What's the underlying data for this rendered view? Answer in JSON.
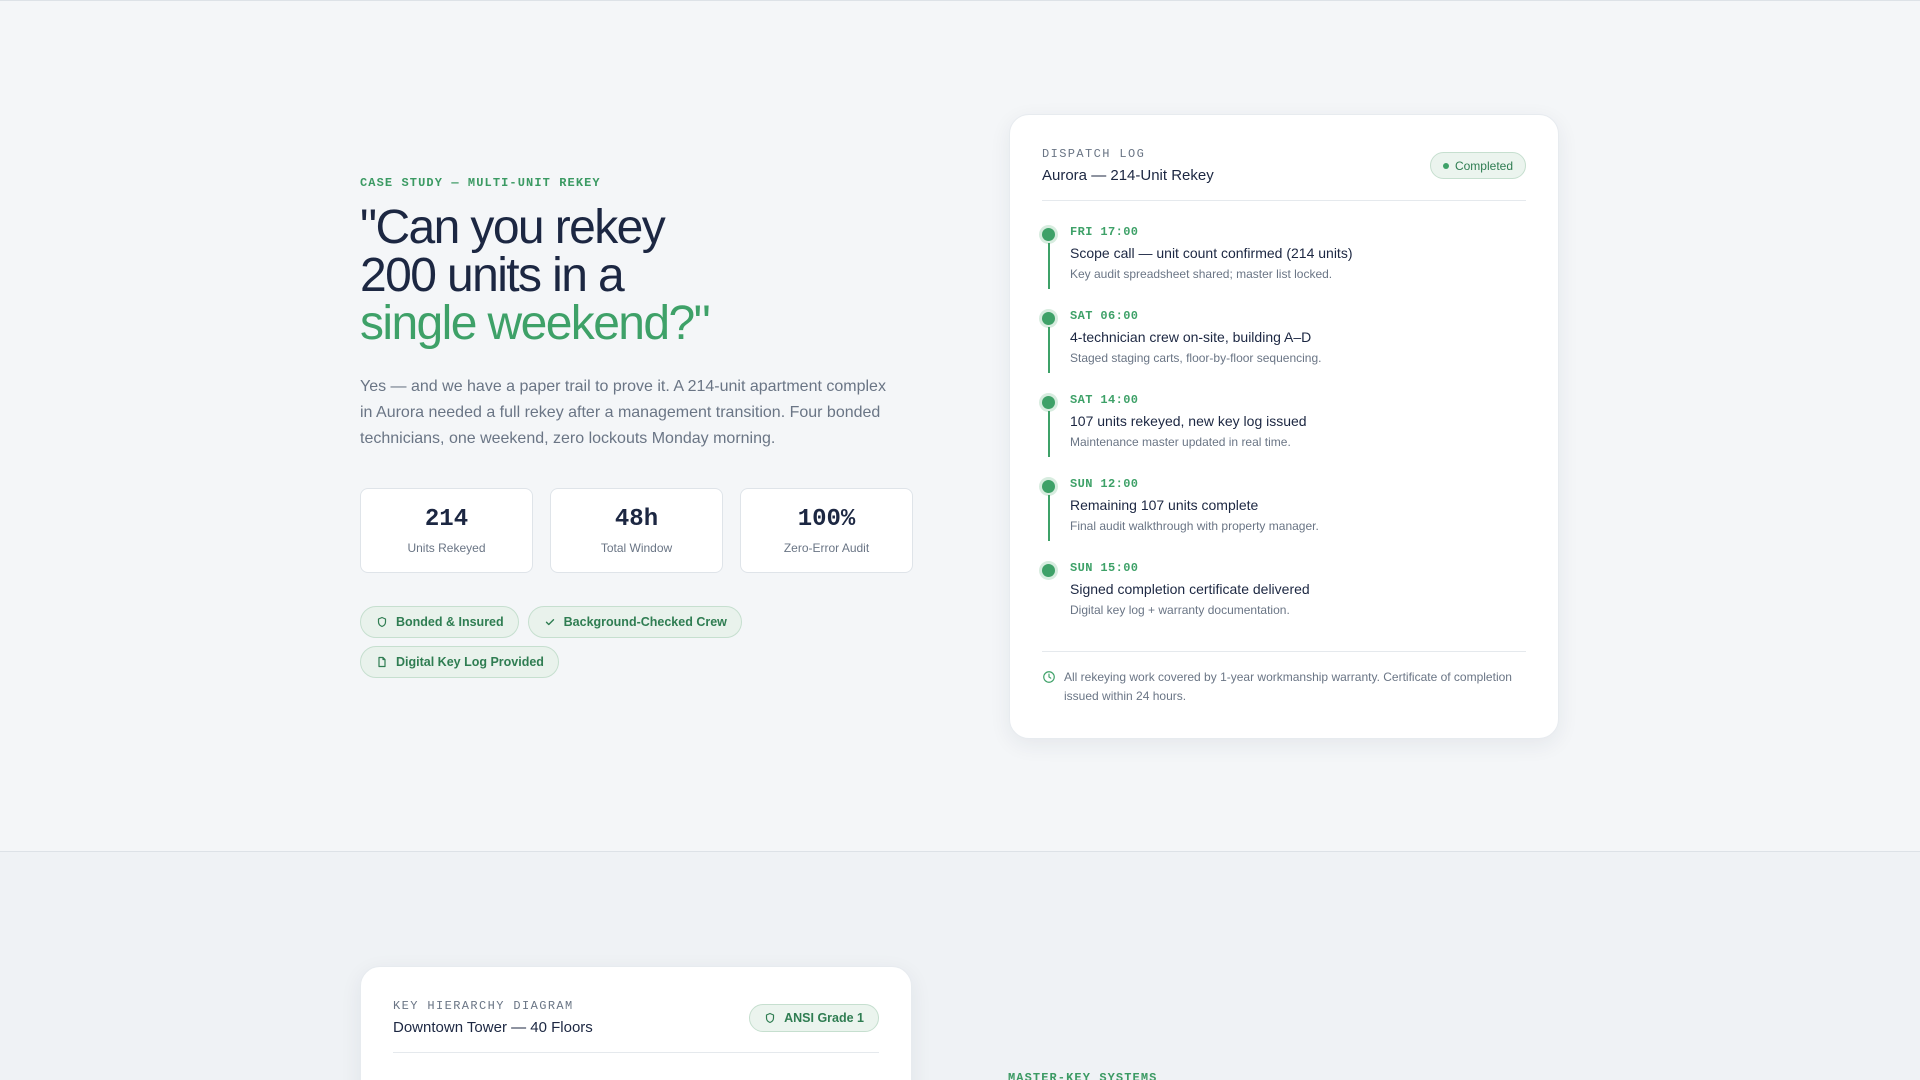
{
  "hero": {
    "eyebrow": "CASE STUDY — MULTI-UNIT REKEY",
    "headline_line1": "\"Can you rekey",
    "headline_line2": "200 units in a",
    "headline_accent": "single weekend?\"",
    "lede": "Yes — and we have a paper trail to prove it. A 214-unit apartment complex in Aurora needed a full rekey after a management transition. Four bonded technicians, one weekend, zero lockouts Monday morning.",
    "stats": [
      {
        "value": "214",
        "label": "Units Rekeyed"
      },
      {
        "value": "48h",
        "label": "Total Window"
      },
      {
        "value": "100%",
        "label": "Zero-Error Audit"
      }
    ],
    "badges": [
      {
        "label": "Bonded & Insured",
        "icon": "shield-icon"
      },
      {
        "label": "Background-Checked Crew",
        "icon": "check-icon"
      },
      {
        "label": "Digital Key Log Provided",
        "icon": "document-icon"
      }
    ]
  },
  "dispatch": {
    "kicker": "DISPATCH LOG",
    "title": "Aurora — 214-Unit Rekey",
    "status": "Completed",
    "entries": [
      {
        "time": "FRI 17:00",
        "title": "Scope call — unit count confirmed (214 units)",
        "desc": "Key audit spreadsheet shared; master list locked."
      },
      {
        "time": "SAT 06:00",
        "title": "4-technician crew on-site, building A–D",
        "desc": "Staged staging carts, floor-by-floor sequencing."
      },
      {
        "time": "SAT 14:00",
        "title": "107 units rekeyed, new key log issued",
        "desc": "Maintenance master updated in real time."
      },
      {
        "time": "SUN 12:00",
        "title": "Remaining 107 units complete",
        "desc": "Final audit walkthrough with property manager."
      },
      {
        "time": "SUN 15:00",
        "title": "Signed completion certificate delivered",
        "desc": "Digital key log + warranty documentation."
      }
    ],
    "footer": "All rekeying work covered by 1-year workmanship warranty. Certificate of completion issued within 24 hours."
  },
  "key_hierarchy": {
    "kicker": "KEY HIERARCHY DIAGRAM",
    "title": "Downtown Tower — 40 Floors",
    "grade": "ANSI Grade 1"
  },
  "section2": {
    "eyebrow": "MASTER-KEY SYSTEMS"
  },
  "colors": {
    "accent": "#3ea168",
    "navy": "#1c2742",
    "muted": "#6a7585"
  }
}
